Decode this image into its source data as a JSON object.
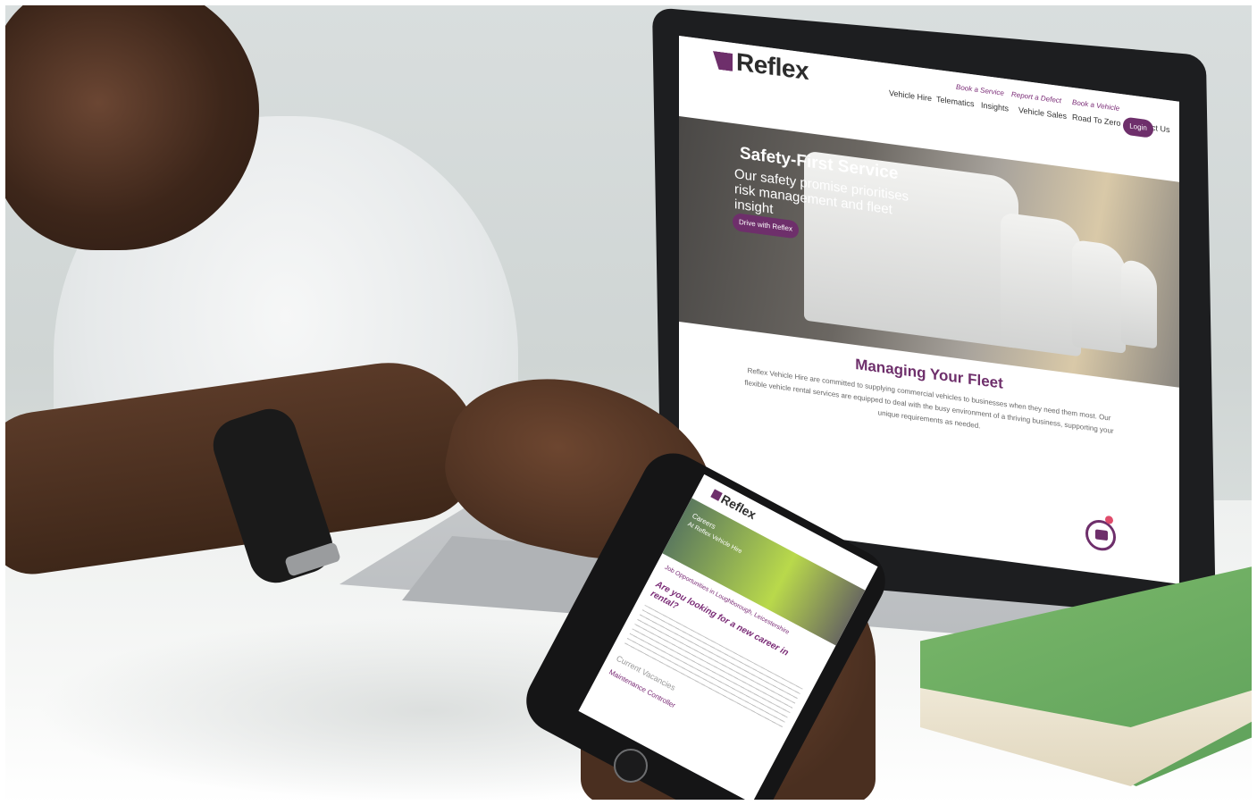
{
  "laptop_site": {
    "logo": "Reflex",
    "utility_links": [
      "Book a Service",
      "Report a Defect",
      "Book a Vehicle"
    ],
    "nav": [
      "Vehicle Hire",
      "Telematics",
      "Insights",
      "Vehicle Sales",
      "Road To Zero",
      "Contact Us"
    ],
    "login_label": "Login",
    "hero": {
      "title": "Safety-First Service",
      "subtitle": "Our safety promise prioritises risk management and fleet insight",
      "cta": "Drive with Reflex"
    },
    "section": {
      "title": "Managing Your Fleet",
      "body": "Reflex Vehicle Hire are committed to supplying commercial vehicles to businesses when they need them most. Our flexible vehicle rental services are equipped to deal with the busy environment of a thriving business, supporting your unique requirements as needed."
    }
  },
  "phone_site": {
    "logo": "Reflex",
    "hero_title": "Careers",
    "hero_subtitle": "At Reflex Vehicle Hire",
    "jobs_heading": "Job Opportunities in Loughborough, Leicestershire",
    "question": "Are you looking for a new career in rental?",
    "vacancies_heading": "Current Vacancies",
    "vacancy_role": "Maintenance Controller"
  },
  "colors": {
    "brand": "#6e2f6b",
    "book": "#6aa95f"
  }
}
